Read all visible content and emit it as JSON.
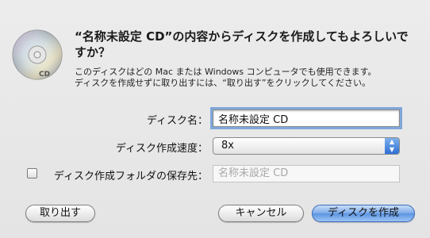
{
  "dialog": {
    "title": "“名称未設定 CD”の内容からディスクを作成してもよろしいですか？",
    "info_line1": "このディスクはどの Mac または Windows コンピュータでも使用できます。",
    "info_line2": "ディスクを作成せずに取り出すには、“取り出す”をクリックしてください。"
  },
  "form": {
    "disc_name_label": "ディスク名：",
    "disc_name_value": "名称未設定 CD",
    "speed_label": "ディスク作成速度：",
    "speed_value": "8x",
    "save_folder_label": "ディスク作成フォルダの保存先：",
    "save_folder_value": "名称未設定 CD",
    "save_folder_checked": false
  },
  "buttons": {
    "eject": "取り出す",
    "cancel": "キャンセル",
    "burn": "ディスクを作成"
  },
  "colors": {
    "accent": "#5a93e2",
    "focus_ring": "#7fa8db"
  }
}
